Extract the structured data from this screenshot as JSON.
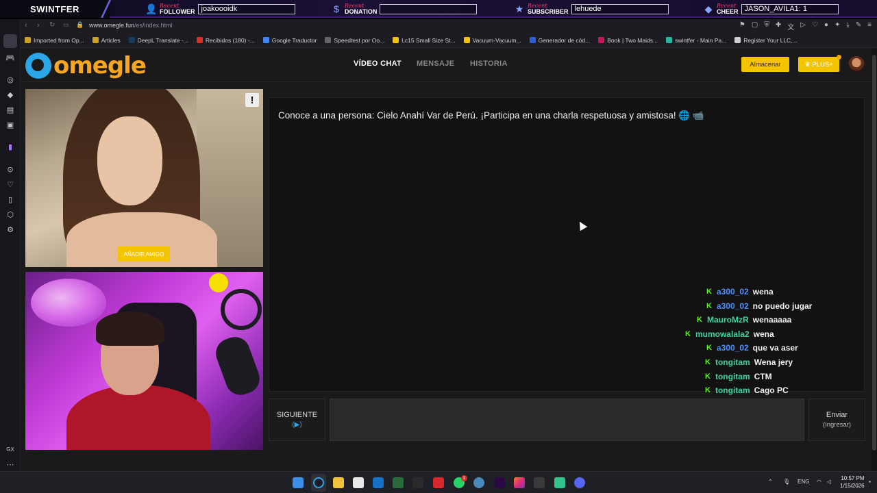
{
  "overlay": {
    "brand": "SWINTFER",
    "recent_label": "Recent",
    "follower": {
      "type": "FOLLOWER",
      "value": "joakooоidk"
    },
    "donation": {
      "type": "DONATION",
      "value": ""
    },
    "subscriber": {
      "type": "SUBSCRIBER",
      "value": "lehuede"
    },
    "cheer": {
      "type": "CHEER",
      "value": "JASON_AVILA1: 1"
    }
  },
  "browser": {
    "url_domain": "www.omegle.fun",
    "url_path": "/es/index.html",
    "bookmarks": [
      {
        "label": "Imported from Op...",
        "color": "#c9a227"
      },
      {
        "label": "Articles",
        "color": "#c9a227"
      },
      {
        "label": "DeepL Translate -...",
        "color": "#1b3a5c"
      },
      {
        "label": "Recibidos (180) -...",
        "color": "#d93025"
      },
      {
        "label": "Google Traductor",
        "color": "#4285f4"
      },
      {
        "label": "Speedtest por Oo...",
        "color": "#666666"
      },
      {
        "label": "Lc15 Small Size St...",
        "color": "#f5c400"
      },
      {
        "label": "Vacuum-Vacuum...",
        "color": "#f5c400"
      },
      {
        "label": "Generador de cód...",
        "color": "#2b5fd9"
      },
      {
        "label": "Book | Two Maids...",
        "color": "#c2185b"
      },
      {
        "label": "swintfer - Main Pa...",
        "color": "#2bb5a0"
      },
      {
        "label": "Register Your LLC,...",
        "color": "#cfcfcf"
      }
    ],
    "leftbar_bottom": "GX"
  },
  "site": {
    "logo_text": "omegle",
    "nav": [
      "VÍDEO CHAT",
      "MENSAJE",
      "HISTORIA"
    ],
    "store_button": "Almacenar",
    "plus_button": "♛ PLUS+"
  },
  "stranger_video": {
    "report_label": "!",
    "add_friend_label": "AÑADIR AMIGO"
  },
  "chat": {
    "intro": "Conoce a una persona: Cielo Anahí Var de Perú. ¡Participa en una charla respetuosa y amistosa! 🌐 📹",
    "stream_messages": [
      {
        "user": "a300_02",
        "text": "wena",
        "color": "#4a90ff"
      },
      {
        "user": "a300_02",
        "text": "no puedo jugar",
        "color": "#4a90ff"
      },
      {
        "user": "MauroMzR",
        "text": "wenaaaaa",
        "color": "#3fd2a0"
      },
      {
        "user": "mumowalala2",
        "text": "wena",
        "color": "#3fd2a0"
      },
      {
        "user": "a300_02",
        "text": "que va aser",
        "color": "#4a90ff"
      },
      {
        "user": "tongitam",
        "text": "Wena jery",
        "color": "#3fd2a0"
      },
      {
        "user": "tongitam",
        "text": "CTM",
        "color": "#3fd2a0"
      },
      {
        "user": "tongitam",
        "text": "Cago PC",
        "color": "#3fd2a0"
      }
    ],
    "kick_glyph": "K"
  },
  "controls": {
    "next_label": "SIGUIENTE",
    "next_hint": "(▶)",
    "send_label": "Enviar",
    "send_hint": "(Ingresar)",
    "message_value": ""
  },
  "taskbar": {
    "lang": "ENG",
    "time": "10:57 PM",
    "date": "1/15/2026",
    "whatsapp_badge": "3"
  }
}
